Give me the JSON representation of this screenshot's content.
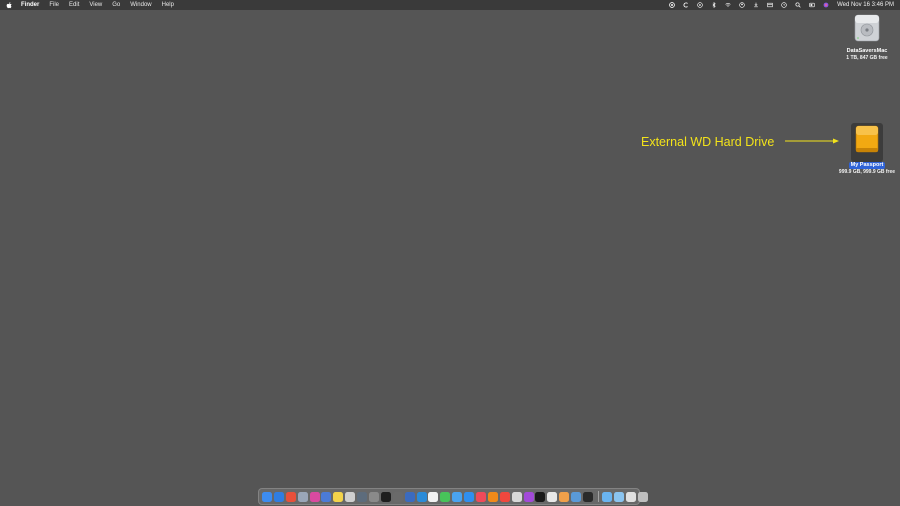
{
  "menubar": {
    "apple_icon": "apple-logo-icon",
    "app_name": "Finder",
    "menus": [
      "File",
      "Edit",
      "View",
      "Go",
      "Window",
      "Help"
    ],
    "status_icons": [
      "screen-record-icon",
      "refresh-c-icon",
      "play-circle-icon",
      "bluetooth-icon",
      "wifi-icon",
      "user-icon",
      "battery-icon",
      "airdrop-icon",
      "clock-icon",
      "spotlight-search-icon",
      "control-center-icon",
      "siri-icon"
    ],
    "clock": "Wed Nov 16  3:46 PM"
  },
  "desktop": {
    "items": [
      {
        "name": "DataSaversMac",
        "info": "1 TB, 847 GB free",
        "icon": "internal-drive-icon",
        "selected": false
      },
      {
        "name": "My Passport",
        "info": "999.9 GB, 999.9 GB free",
        "icon": "external-drive-icon",
        "selected": true
      }
    ],
    "annotation": "External WD Hard Drive",
    "annotation_color": "#f3e31a"
  },
  "dock": {
    "apps": [
      {
        "name": "finder-icon",
        "color": "#3d8cf0"
      },
      {
        "name": "safari-icon",
        "color": "#2f7de1"
      },
      {
        "name": "chrome-icon",
        "color": "#e8503a"
      },
      {
        "name": "photos-preview-icon",
        "color": "#9aa6b8"
      },
      {
        "name": "app-icon-4",
        "color": "#d94aa0"
      },
      {
        "name": "app-icon-5",
        "color": "#4b7bd6"
      },
      {
        "name": "notes-icon",
        "color": "#f3d34a"
      },
      {
        "name": "app-icon-7",
        "color": "#cfcfcf"
      },
      {
        "name": "app-icon-8",
        "color": "#5d6c7c"
      },
      {
        "name": "app-icon-9",
        "color": "#8a8a8a"
      },
      {
        "name": "terminal-icon",
        "color": "#1e1e1e"
      },
      {
        "name": "app-icon-11",
        "color": "#6a6a6a"
      },
      {
        "name": "app-icon-12",
        "color": "#3b6bbf"
      },
      {
        "name": "app-icon-13",
        "color": "#2b8bd8"
      },
      {
        "name": "calendar-icon",
        "color": "#f2f2f2"
      },
      {
        "name": "messages-icon",
        "color": "#48c35a"
      },
      {
        "name": "mail-icon",
        "color": "#4aa3f0"
      },
      {
        "name": "app-store-icon",
        "color": "#2f8ff0"
      },
      {
        "name": "music-icon",
        "color": "#f04a5a"
      },
      {
        "name": "vlc-icon",
        "color": "#f08a1a"
      },
      {
        "name": "news-icon",
        "color": "#f0483e"
      },
      {
        "name": "app-icon-21",
        "color": "#d8d8d8"
      },
      {
        "name": "podcasts-icon",
        "color": "#a24ad8"
      },
      {
        "name": "tv-icon",
        "color": "#1a1a1a"
      },
      {
        "name": "document-icon",
        "color": "#e8e8e8"
      },
      {
        "name": "photos-icon",
        "color": "#f0a04a"
      },
      {
        "name": "app-icon-26",
        "color": "#5a9ad8"
      },
      {
        "name": "app-icon-27",
        "color": "#2a2a2a"
      }
    ],
    "folders": [
      {
        "name": "downloads-folder-icon",
        "color": "#6ab4f0"
      },
      {
        "name": "documents-folder-icon",
        "color": "#8ac4f0"
      },
      {
        "name": "folder-icon",
        "color": "#e0e0e0"
      },
      {
        "name": "trash-icon",
        "color": "#bfbfbf"
      }
    ]
  }
}
